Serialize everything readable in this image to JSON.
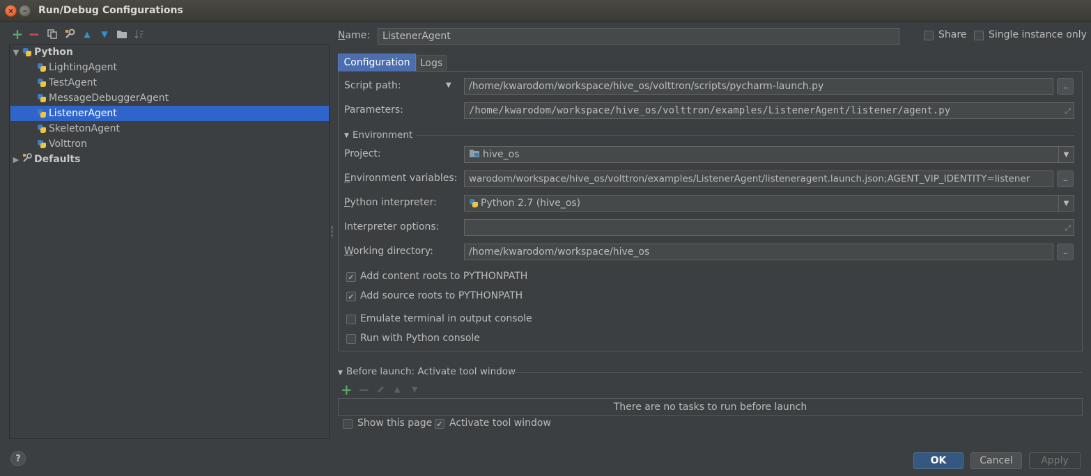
{
  "window": {
    "title": "Run/Debug Configurations"
  },
  "toolbar": {
    "icons": [
      "add-icon",
      "remove-icon",
      "copy-icon",
      "wrench-icon",
      "move-up-icon",
      "move-down-icon",
      "folder-icon",
      "sort-icon"
    ],
    "add_glyph": "+",
    "remove_glyph": "−",
    "up_glyph": "▲",
    "down_glyph": "▼"
  },
  "tree": {
    "root": "Python",
    "items": [
      "LightingAgent",
      "TestAgent",
      "MessageDebuggerAgent",
      "ListenerAgent",
      "SkeletonAgent",
      "Volttron"
    ],
    "selected": "ListenerAgent",
    "defaults": "Defaults"
  },
  "header": {
    "name_label": "Name:",
    "name_value": "ListenerAgent",
    "share_label": "Share",
    "single_instance_label": "Single instance only",
    "share_checked": false,
    "single_instance_checked": false
  },
  "tabs": [
    {
      "label": "Configuration",
      "active": true
    },
    {
      "label": "Logs",
      "active": false
    }
  ],
  "config": {
    "script_path_label": "Script path:",
    "script_path_value": "/home/kwarodom/workspace/hive_os/volttron/scripts/pycharm-launch.py",
    "parameters_label": "Parameters:",
    "parameters_value": "/home/kwarodom/workspace/hive_os/volttron/examples/ListenerAgent/listener/agent.py",
    "environment_section": "Environment",
    "project_label": "Project:",
    "project_value": "hive_os",
    "env_vars_label": "Environment variables:",
    "env_vars_value": "warodom/workspace/hive_os/volttron/examples/ListenerAgent/listeneragent.launch.json;AGENT_VIP_IDENTITY=listener",
    "interpreter_label": "Python interpreter:",
    "interpreter_value": "Python 2.7 (hive_os)",
    "interp_options_label": "Interpreter options:",
    "interp_options_value": "",
    "working_dir_label": "Working directory:",
    "working_dir_value": "/home/kwarodom/workspace/hive_os",
    "browse_glyph": "...",
    "checkboxes": [
      {
        "label": "Add content roots to PYTHONPATH",
        "checked": true
      },
      {
        "label": "Add source roots to PYTHONPATH",
        "checked": true
      },
      {
        "label": "Emulate terminal in output console",
        "checked": false
      },
      {
        "label": "Run with Python console",
        "checked": false
      }
    ]
  },
  "before_launch": {
    "title": "Before launch: Activate tool window",
    "empty_text": "There are no tasks to run before launch",
    "show_page_label": "Show this page",
    "activate_label": "Activate tool window",
    "show_page_checked": false,
    "activate_checked": true
  },
  "footer": {
    "help_glyph": "?",
    "ok_label": "OK",
    "cancel_label": "Cancel",
    "apply_label": "Apply"
  },
  "colors": {
    "background": "#3c3f41",
    "selection": "#2f65ca",
    "add_green": "#59a869",
    "remove_red": "#c75450",
    "arrow_blue": "#3592c4"
  }
}
